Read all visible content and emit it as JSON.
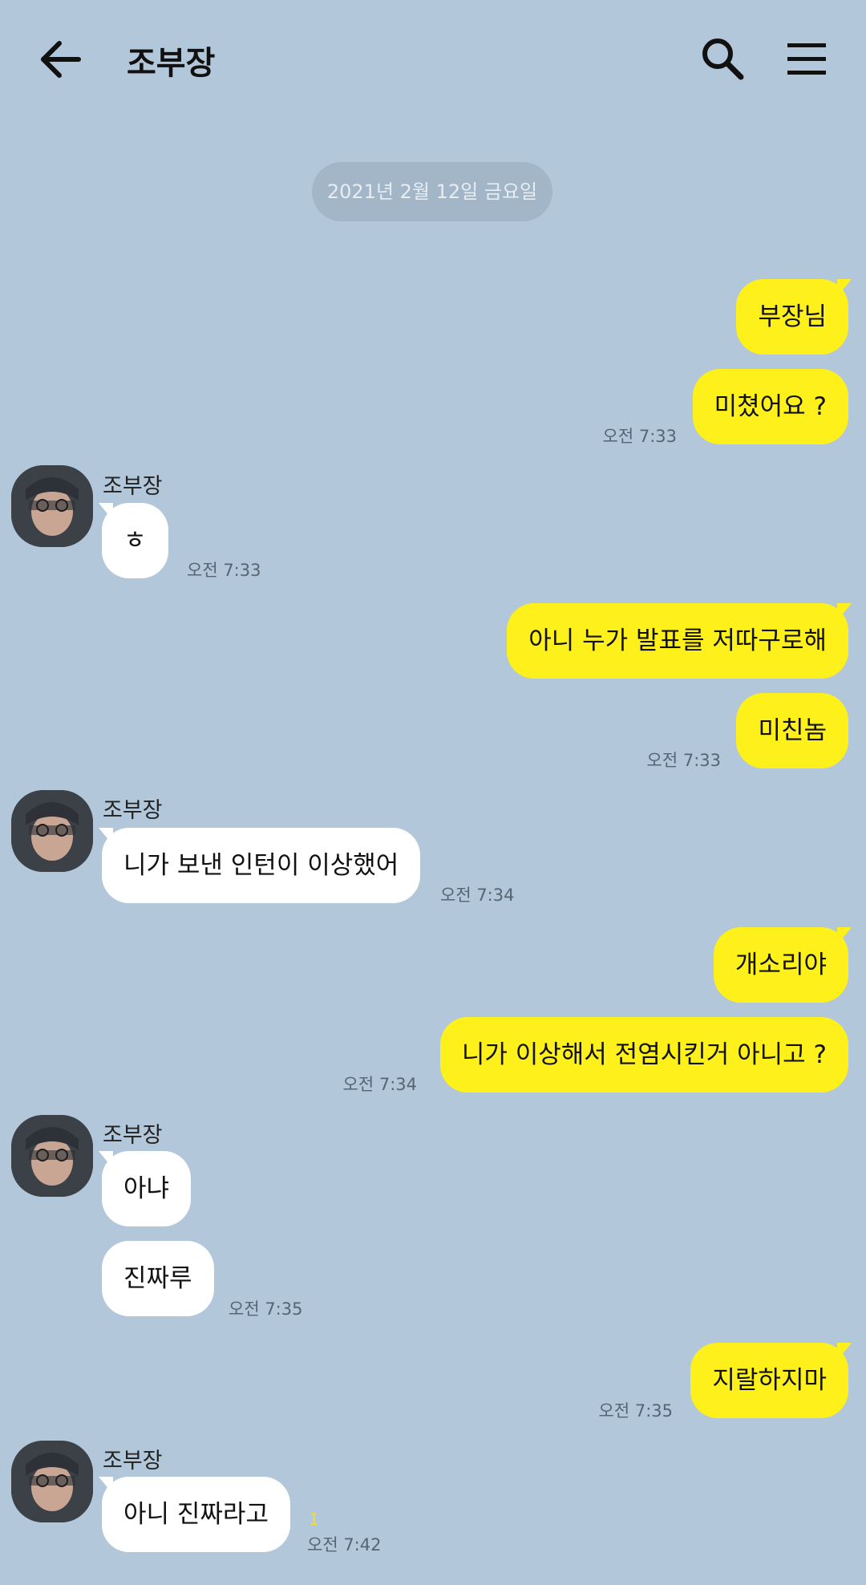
{
  "header": {
    "title": "조부장"
  },
  "date_divider": "2021년 2월 12일 금요일",
  "sender_name": "조부장",
  "messages": [
    {
      "text": "부장님"
    },
    {
      "text": "미쳤어요 ?",
      "time": "오전 7:33"
    },
    {
      "text": "ㅎ",
      "time": "오전 7:33"
    },
    {
      "text": "아니 누가 발표를 저따구로해"
    },
    {
      "text": "미친놈",
      "time": "오전 7:33"
    },
    {
      "text": "니가 보낸 인턴이 이상했어",
      "time": "오전 7:34"
    },
    {
      "text": "개소리야"
    },
    {
      "text": "니가 이상해서 전염시킨거 아니고 ?",
      "time": "오전 7:34"
    },
    {
      "text": "아냐"
    },
    {
      "text": "진짜루",
      "time": "오전 7:35"
    },
    {
      "text": "지랄하지마",
      "time": "오전 7:35"
    },
    {
      "text": "아니 진짜라고",
      "time": "오전 7:42",
      "unread": "1"
    }
  ],
  "colors": {
    "background": "#b2c7da",
    "my_bubble": "#fef01b",
    "their_bubble": "#ffffff",
    "date_pill": "#a2b6c8"
  },
  "icons": [
    "back-arrow-icon",
    "search-icon",
    "menu-icon"
  ]
}
